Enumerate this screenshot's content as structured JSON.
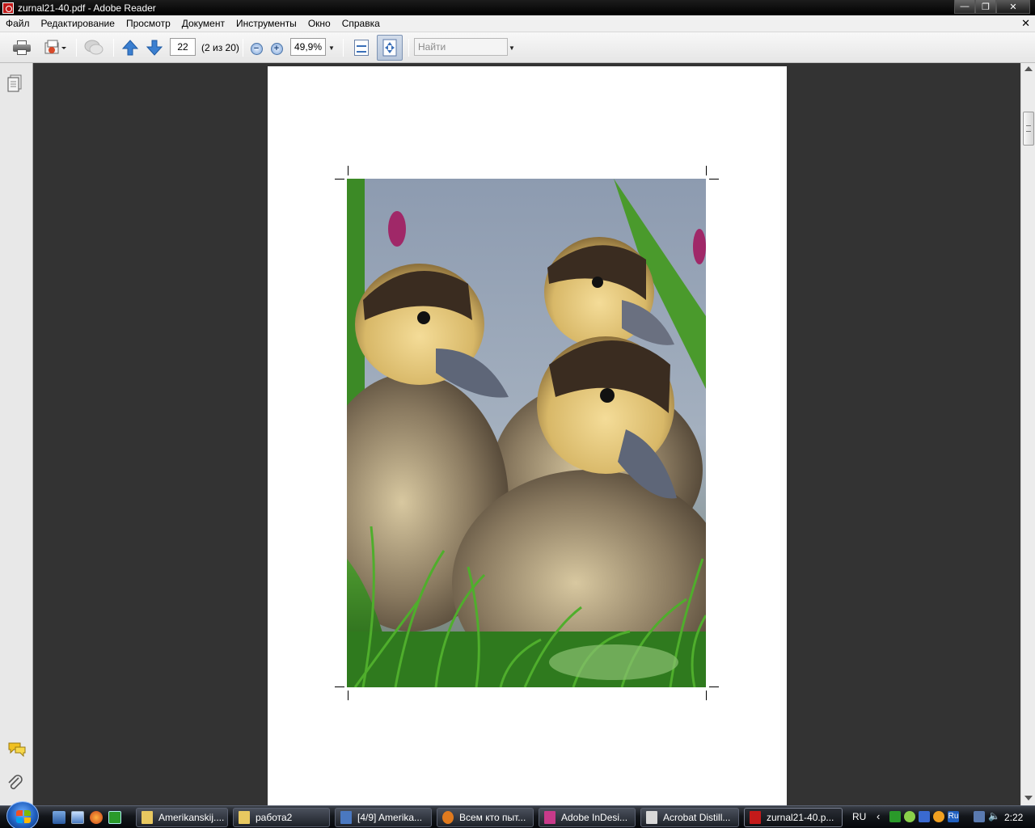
{
  "window": {
    "title": "zurnal21-40.pdf - Adobe Reader"
  },
  "menu": [
    "Файл",
    "Редактирование",
    "Просмотр",
    "Документ",
    "Инструменты",
    "Окно",
    "Справка"
  ],
  "toolbar": {
    "page_number": "22",
    "page_count": "(2 из 20)",
    "zoom": "49,9%",
    "search_placeholder": "Найти"
  },
  "document": {
    "image_subject": "three ducklings in green grass by water"
  },
  "taskbar": {
    "tasks": [
      {
        "label": "Amerikanskij....",
        "icon": "folder-icon",
        "color": "#e8c860"
      },
      {
        "label": "работа2",
        "icon": "folder-icon",
        "color": "#e8c860"
      },
      {
        "label": "[4/9] Amerika...",
        "icon": "image-viewer-icon",
        "color": "#4a78c0"
      },
      {
        "label": "Всем кто пыт...",
        "icon": "firefox-icon",
        "color": "#e07a1e"
      },
      {
        "label": "Adobe InDesi...",
        "icon": "indesign-icon",
        "color": "#c83a8a"
      },
      {
        "label": "Acrobat Distill...",
        "icon": "distiller-icon",
        "color": "#d8d8d8"
      },
      {
        "label": "zurnal21-40.p...",
        "icon": "adobe-reader-icon",
        "color": "#c41a1a"
      }
    ],
    "tray": {
      "language": "RU",
      "clock": "2:22",
      "keyboard_layout": "Ru"
    }
  },
  "colors": {
    "doc_background": "#333333",
    "chrome_background": "#f0f0f0"
  }
}
